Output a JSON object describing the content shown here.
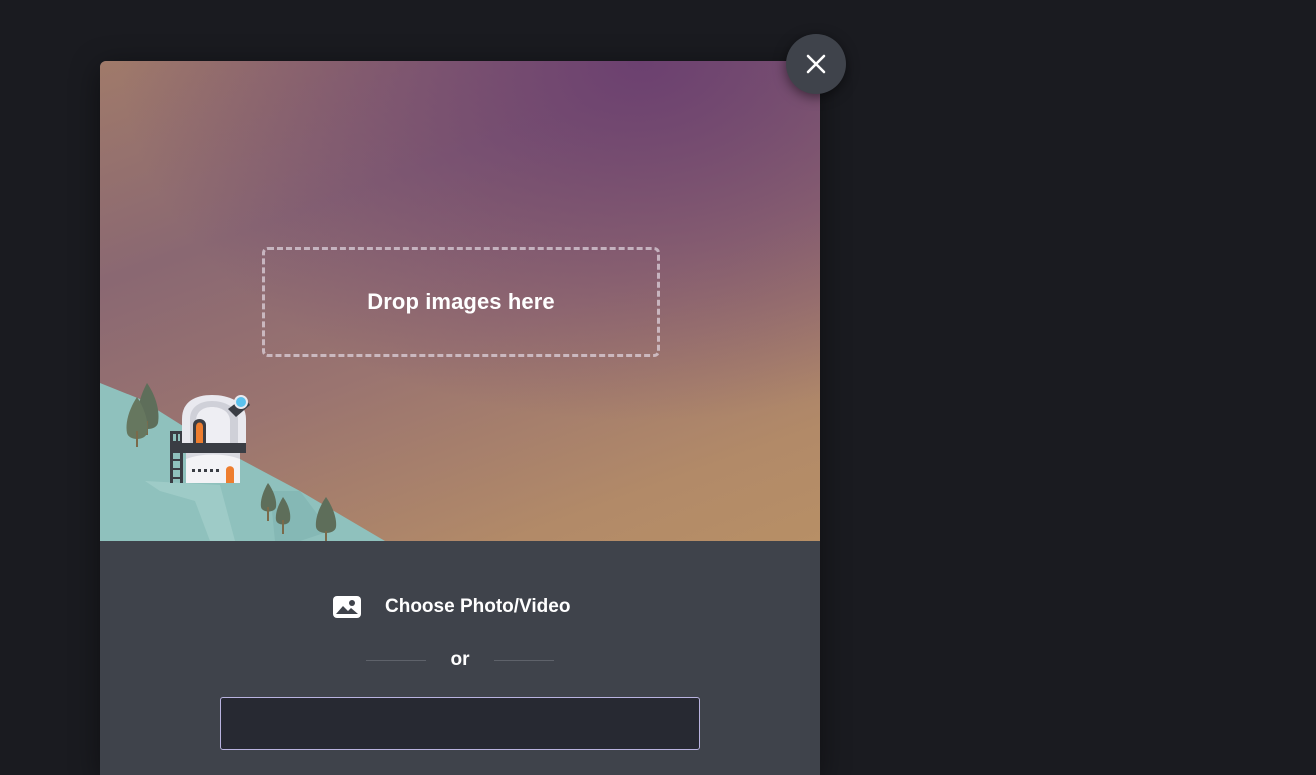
{
  "modal": {
    "dropzone": {
      "label": "Drop images here"
    },
    "choose": {
      "label": "Choose Photo/Video",
      "icon": "image-icon"
    },
    "divider": {
      "label": "or"
    },
    "url_input": {
      "value": "",
      "placeholder": ""
    },
    "close": {
      "icon": "close-icon"
    }
  },
  "colors": {
    "page_background": "#1a1b20",
    "panel_background": "#3f434b",
    "input_background": "#272932",
    "input_border": "#b9b3e0",
    "hill": "#8fc1bd",
    "tree": "#5e6e5a",
    "accent_orange": "#ee7d2e",
    "accent_blue": "#5bc2ee"
  }
}
